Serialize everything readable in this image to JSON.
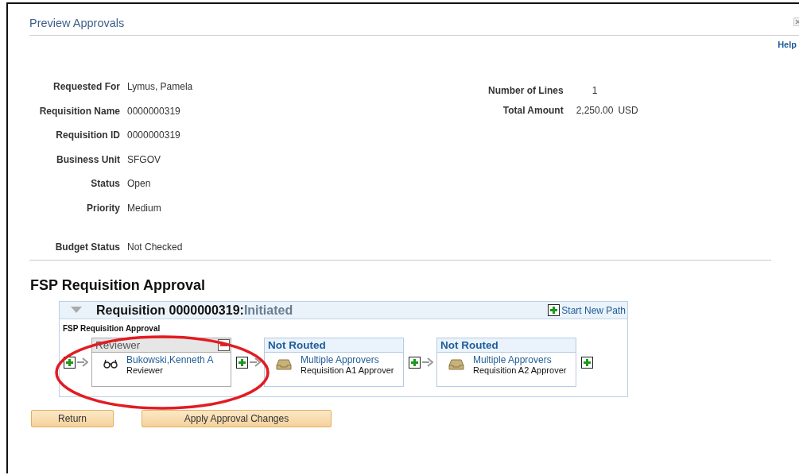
{
  "window": {
    "title": "Preview Approvals",
    "help": "Help"
  },
  "fields_left": [
    {
      "label": "Requested For",
      "value": "Lymus, Pamela"
    },
    {
      "label": "Requisition Name",
      "value": "0000000319"
    },
    {
      "label": "Requisition ID",
      "value": "0000000319"
    },
    {
      "label": "Business Unit",
      "value": "SFGOV"
    },
    {
      "label": "Status",
      "value": "Open"
    },
    {
      "label": "Priority",
      "value": "Medium"
    },
    {
      "label": "Budget Status",
      "value": "Not Checked"
    }
  ],
  "fields_right": [
    {
      "label": "Number of Lines",
      "value": "1"
    },
    {
      "label": "Total Amount",
      "value": "2,250.00",
      "unit": "USD"
    }
  ],
  "section_title": "FSP Requisition Approval",
  "approval": {
    "title": "Requisition 0000000319:",
    "status": "Initiated",
    "expanded": true,
    "start_new_path": "Start New Path",
    "path_name": "FSP Requisition Approval",
    "steps": [
      {
        "kind": "reviewer",
        "header": "Reviewer",
        "name": "Bukowski,Kenneth A",
        "role": "Reviewer"
      },
      {
        "kind": "not_routed",
        "header": "Not Routed",
        "name": "Multiple Approvers",
        "role": "Requisition A1 Approver"
      },
      {
        "kind": "not_routed",
        "header": "Not Routed",
        "name": "Multiple Approvers",
        "role": "Requisition A2 Approver"
      }
    ]
  },
  "buttons": [
    "Return",
    "Apply Approval Changes"
  ]
}
